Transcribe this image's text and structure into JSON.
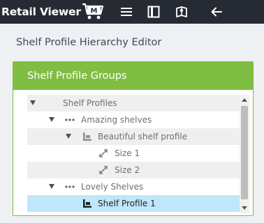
{
  "app": {
    "logo_text": "Retail Viewer",
    "logo_badge": "M"
  },
  "toolbar": {
    "icons": [
      "list-icon",
      "panel-icon",
      "book-pin-icon",
      "back-arrow-icon"
    ]
  },
  "page": {
    "title": "Shelf Profile Hierarchy Editor"
  },
  "panel": {
    "header": "Shelf Profile Groups"
  },
  "tree": {
    "items": [
      {
        "label": "Shelf Profiles",
        "icon": "none"
      },
      {
        "label": "Amazing shelves",
        "icon": "dots-icon"
      },
      {
        "label": "Beautiful shelf profile",
        "icon": "shelf-profile-icon"
      },
      {
        "label": "Size 1",
        "icon": "resize-icon"
      },
      {
        "label": "Size 2",
        "icon": "resize-icon"
      },
      {
        "label": "Lovely Shelves",
        "icon": "dots-icon"
      },
      {
        "label": "Shelf Profile 1",
        "icon": "shelf-profile-icon",
        "selected": true
      }
    ]
  },
  "colors": {
    "topbar": "#262b33",
    "panel_header": "#80be43",
    "selected_row": "#bfe6fb",
    "alt_row": "#efefef"
  }
}
